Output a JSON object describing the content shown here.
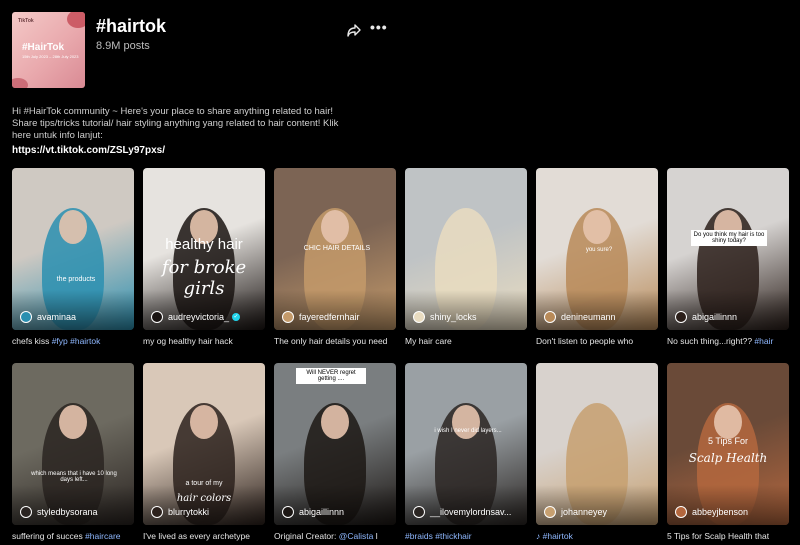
{
  "header": {
    "cover": {
      "brand": "TikTok",
      "title": "#HairTok",
      "subtitle": "15th July 2023 – 28th July 2023"
    },
    "title": "#hairtok",
    "posts": "8.9M posts",
    "share_icon": "share-icon",
    "more_icon": "more-icon",
    "more_label": "•••"
  },
  "description": {
    "text": "Hi #HairTok community ~ Here's your place to share anything related to hair! Share tips/tricks tutorial/ hair styling anything yang related to hair content! Klik here untuk info lanjut:",
    "link": "https://vt.tiktok.com/ZSLy97pxs/"
  },
  "videos": [
    {
      "username": "avaminaa",
      "caption": "chefs kiss ",
      "tags": "#fyp #hairtok",
      "overlay": "the products",
      "verified": false,
      "colors": [
        "#cfc9c2",
        "#2a8fb0"
      ]
    },
    {
      "username": "audreyvictoria_",
      "caption": "my og healthy hair hack",
      "tags": "",
      "overlay": "healthy hair",
      "overlay2": "for broke girls",
      "verified": true,
      "colors": [
        "#e6e3df",
        "#1a1412"
      ]
    },
    {
      "username": "fayeredfernhair",
      "caption": "The only hair details you need",
      "tags": "",
      "overlay": "CHIC HAIR DETAILS",
      "verified": false,
      "colors": [
        "#7c6454",
        "#c49a6a"
      ]
    },
    {
      "username": "shiny_locks",
      "caption": "My hair care ",
      "tags": "",
      "overlay": "",
      "verified": false,
      "colors": [
        "#bfc3c5",
        "#e9dcc0"
      ]
    },
    {
      "username": "denineumann",
      "caption": "Don't listen to people who",
      "tags": "",
      "overlay": "you sure?",
      "verified": false,
      "colors": [
        "#e2dcd6",
        "#b88a58"
      ]
    },
    {
      "username": "abigaillinnn",
      "caption": "No such thing...right?? ",
      "tags": "#hair",
      "overlay": "Do you think my hair is too shiny today?",
      "verified": false,
      "colors": [
        "#d6d3d1",
        "#2b1f1a"
      ]
    },
    {
      "username": "styledbysorana",
      "caption": "suffering of succes ",
      "tags": "#haircare",
      "overlay": "which means that i have 10 long days left...",
      "verified": false,
      "colors": [
        "#6d6a60",
        "#2a2421"
      ]
    },
    {
      "username": "blurrytokki",
      "caption": "I've lived as every archetype",
      "tags": "",
      "overlay": "a tour of my",
      "overlay2": "hair colors",
      "verified": false,
      "colors": [
        "#d9c8b8",
        "#2c211c"
      ]
    },
    {
      "username": "abigaillinnn",
      "caption": "Original Creator: ",
      "tags": "@Calista",
      "tail": " l",
      "overlay": "Will NEVER regret getting ....",
      "verified": false,
      "colors": [
        "#7a7e80",
        "#1c1714"
      ]
    },
    {
      "username": "__ilovemylordnsav...",
      "caption": "",
      "tags": "#braids #thickhair",
      "overlay": "i wish I never did layers...",
      "verified": false,
      "colors": [
        "#9aa0a4",
        "#2a2522"
      ]
    },
    {
      "username": "johanneyey",
      "caption": "",
      "tags": "♪ #hairtok",
      "overlay": "",
      "verified": false,
      "colors": [
        "#d8d2cd",
        "#c7a070"
      ]
    },
    {
      "username": "abbeyjbenson",
      "caption": "5 Tips for Scalp Health that",
      "tags": "",
      "overlay": "5 Tips For",
      "overlay2": "Scalp Health",
      "verified": false,
      "colors": [
        "#6a4a38",
        "#b4673e"
      ]
    }
  ]
}
